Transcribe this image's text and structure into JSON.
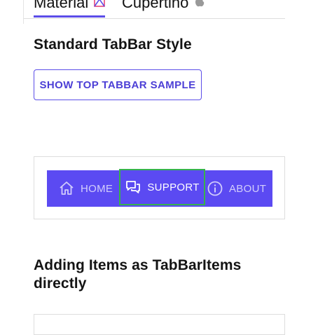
{
  "top_tabs": {
    "items": [
      {
        "label": "Material",
        "icon": "material-icon",
        "selected": true
      },
      {
        "label": "Cupertino",
        "icon": "apple-icon",
        "selected": false
      }
    ],
    "accent": "#5b4de8"
  },
  "section_1": {
    "title": "Standard TabBar Style",
    "button_label": "SHOW TOP TABBAR SAMPLE"
  },
  "tabbar_sample": {
    "background": "#5b4af2",
    "items": [
      {
        "label": "HOME",
        "icon": "home-icon",
        "selected": false
      },
      {
        "label": "SUPPORT",
        "icon": "chat-icon",
        "selected": true
      },
      {
        "label": "ABOUT",
        "icon": "info-icon",
        "selected": false
      }
    ]
  },
  "section_2": {
    "title": "Adding Items as TabBarItems directly"
  }
}
